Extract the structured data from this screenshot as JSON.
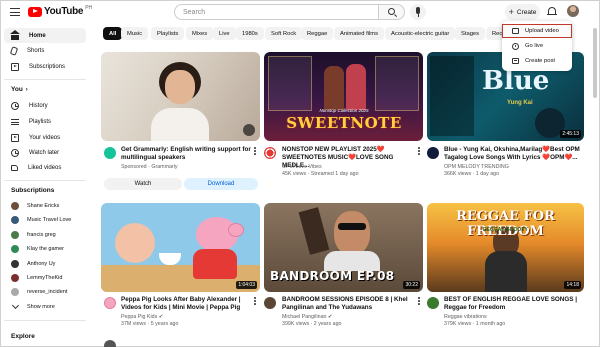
{
  "header": {
    "logo_text": "YouTube",
    "logo_region": "PH",
    "search_placeholder": "Search",
    "create_label": "Create"
  },
  "create_menu": {
    "items": [
      {
        "label": "Upload video",
        "icon": "upload-icon",
        "selected": true
      },
      {
        "label": "Go live",
        "icon": "live-icon",
        "selected": false
      },
      {
        "label": "Create post",
        "icon": "post-icon",
        "selected": false
      }
    ],
    "highlight_color": "#c0392b"
  },
  "sidebar": {
    "main": [
      {
        "label": "Home",
        "icon": "home-icon",
        "active": true
      },
      {
        "label": "Shorts",
        "icon": "shorts-icon",
        "active": false
      },
      {
        "label": "Subscriptions",
        "icon": "subscriptions-icon",
        "active": false
      }
    ],
    "you_heading": "You",
    "you": [
      {
        "label": "History",
        "icon": "history-icon"
      },
      {
        "label": "Playlists",
        "icon": "playlists-icon"
      },
      {
        "label": "Your videos",
        "icon": "your-videos-icon"
      },
      {
        "label": "Watch later",
        "icon": "watch-later-icon"
      },
      {
        "label": "Liked videos",
        "icon": "liked-videos-icon"
      }
    ],
    "subscriptions_heading": "Subscriptions",
    "subscriptions": [
      {
        "label": "Shane Ericks",
        "color": "#6b4f3a"
      },
      {
        "label": "Music Travel Love",
        "color": "#3a5a7a"
      },
      {
        "label": "francis greg",
        "color": "#4a7a4a"
      },
      {
        "label": "Klay the gamer",
        "color": "#2e8b57"
      },
      {
        "label": "Anthony Uy",
        "color": "#333333"
      },
      {
        "label": "LemmyTheKid",
        "color": "#7a2e2e"
      },
      {
        "label": "reverse_incident",
        "color": "#aaaaaa"
      }
    ],
    "show_more": "Show more",
    "explore_heading": "Explore"
  },
  "chips": [
    "All",
    "Music",
    "Playlists",
    "Mixes",
    "Live",
    "1980s",
    "Soft Rock",
    "Reggae",
    "Animated films",
    "Acoustic-electric guitar",
    "Stages",
    "Recen"
  ],
  "videos_row1": [
    {
      "title_line1": "Get Grammarly: English writing support for",
      "title_line2": "multilingual speakers",
      "meta1": "Sponsored · Grammarly",
      "ad": true,
      "button_watch": "Watch",
      "button_download": "Download"
    },
    {
      "title_line1": "NONSTOP NEW PLAYLIST 2025❤️",
      "title_line2": "SWEETNOTES MUSIC❤️LOVE SONG MEDLE...",
      "meta1": "OPM Love Vibes",
      "meta2": "45K views · Streamed 1 day ago",
      "thumb_text": "SWEETNOTE",
      "thumb_subtext": "Nonstop Collection 2025"
    },
    {
      "title_line1": "Blue - Yung Kai, Okshina,Marilag❤️Best OPM",
      "title_line2": "Tagalog Love Songs With Lyrics ❤️OPM❤️...",
      "meta1": "OPM MELODY TRENDING",
      "meta2": "366K views · 1 day ago",
      "thumb_text": "Blue",
      "thumb_subtext": "Yung Kai",
      "duration": "2:45:13"
    }
  ],
  "videos_row2": [
    {
      "title_line1": "Peppa Pig Looks After Baby Alexander |",
      "title_line2": "Videos for Kids | Mini Movie | Peppa Pig",
      "meta1": "Peppa Pig Kids ✔",
      "meta2": "37M views · 5 years ago",
      "duration": "1:04:03"
    },
    {
      "title_line1": "BANDROOM SESSIONS EPISODE 8 | Khel",
      "title_line2": "Pangilinan and The Yudawans",
      "meta1": "Michael Pangilinan ✔",
      "meta2": "399K views · 2 years ago",
      "thumb_text": "BANDROOM EP.08",
      "duration": "30:22"
    },
    {
      "title_line1": "BEST OF ENGLISH REGGAE LOVE SONGS |",
      "title_line2": "Reggae for Freedom",
      "meta1": "Reggae vibrations",
      "meta2": "379K views · 1 month ago",
      "thumb_text": "REGGAE FOR FREEDOM",
      "thumb_subtext": "REGGAE GROOVY",
      "duration": "14:18"
    }
  ]
}
